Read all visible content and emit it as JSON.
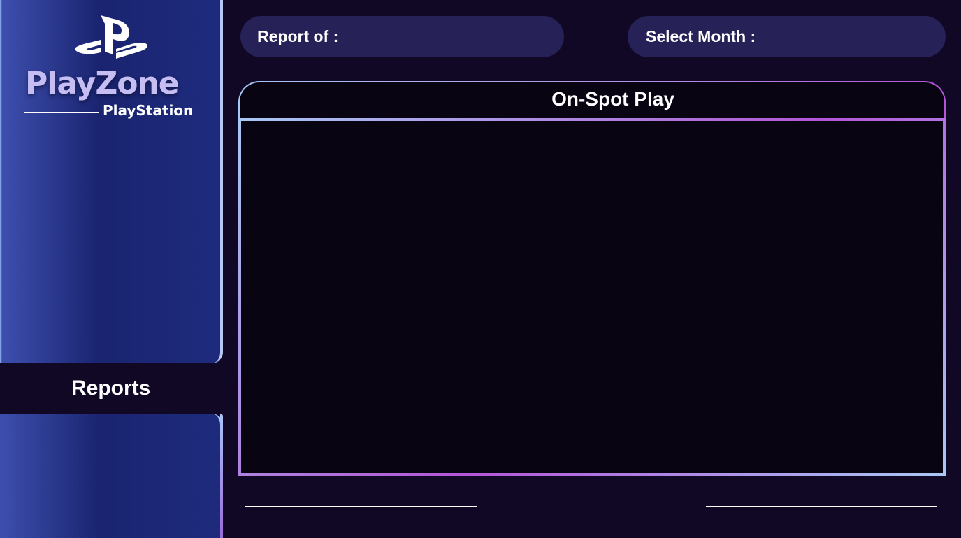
{
  "brand": {
    "name": "PlayZone",
    "subtitle": "PlayStation",
    "logo_icon": "playstation-logo-icon"
  },
  "nav": {
    "items": [
      {
        "label": "Reports",
        "active": true
      }
    ]
  },
  "filters": {
    "report_of_label": "Report of :",
    "report_of_value": "",
    "select_month_label": "Select Month :",
    "select_month_value": ""
  },
  "panel": {
    "title": "On-Spot Play"
  },
  "colors": {
    "background": "#100825",
    "sidebar": "#1a2470",
    "pill": "#262156",
    "accent_blue": "#a8c8f5",
    "accent_purple": "#b455d8"
  }
}
